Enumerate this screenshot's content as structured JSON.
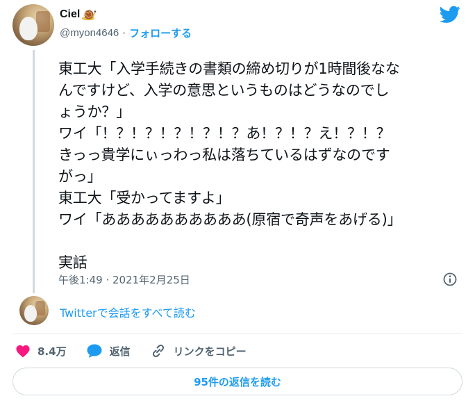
{
  "author": {
    "display_name": "Ciel",
    "handle": "@myon4646",
    "separator": "·",
    "follow_label": "フォローする"
  },
  "tweet": {
    "lines": [
      "東工大「入学手続きの書類の締め切りが1時間後なな",
      "んですけど、入学の意思というものはどうなのでし",
      "ょうか？」",
      "ワイ「！？！？！？！？！？あ！？！？え！？！？",
      "きっっ貴学にぃっわっ私は落ちているはずなのです",
      "がっ」",
      "東工大「受かってますよ」",
      "ワイ「ああああああああああ(原宿で奇声をあげる)」",
      "",
      "実話"
    ],
    "timestamp": "午後1:49 · 2021年2月25日"
  },
  "conversation_link": "Twitterで会話をすべて読む",
  "actions": {
    "likes": "8.4万",
    "reply_label": "返信",
    "copy_link_label": "リンクをコピー"
  },
  "replies_button_label": "95件の返信を読む",
  "colors": {
    "accent": "#1d9bf0",
    "like": "#f91880",
    "secondary_text": "#536471"
  },
  "icons": {
    "snail": "snail-emoji-icon",
    "brand": "twitter-bird-icon",
    "info": "info-icon",
    "like": "heart-icon",
    "reply": "speech-bubble-icon",
    "link": "chain-link-icon"
  }
}
